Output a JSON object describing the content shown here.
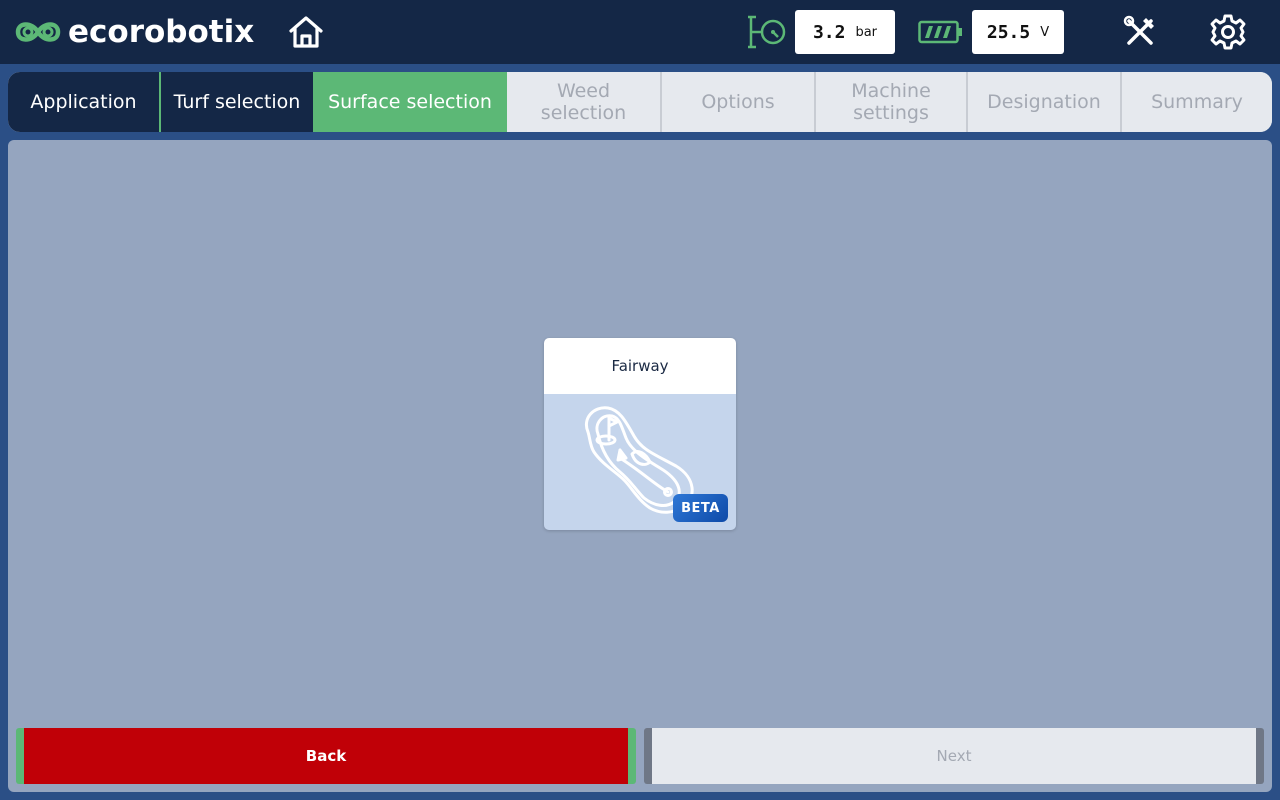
{
  "header": {
    "brand": "ecorobotix",
    "pressure": {
      "value": "3.2",
      "unit": "bar"
    },
    "voltage": {
      "value": "25.5",
      "unit": "V"
    },
    "colors": {
      "bar_bg": "#142746",
      "accent_green": "#5cb876"
    }
  },
  "steps": {
    "application": "Application",
    "turf_selection": "Turf selection",
    "surface_selection": "Surface selection",
    "weed_selection": "Weed selection",
    "options": "Options",
    "machine_settings": "Machine settings",
    "designation": "Designation",
    "summary": "Summary",
    "active": "surface_selection"
  },
  "surface_card": {
    "title": "Fairway",
    "badge": "BETA",
    "icon": "fairway-icon"
  },
  "footer": {
    "back_label": "Back",
    "next_label": "Next",
    "colors": {
      "back_bg": "#c00007",
      "next_bg": "#e6e9ee"
    }
  }
}
